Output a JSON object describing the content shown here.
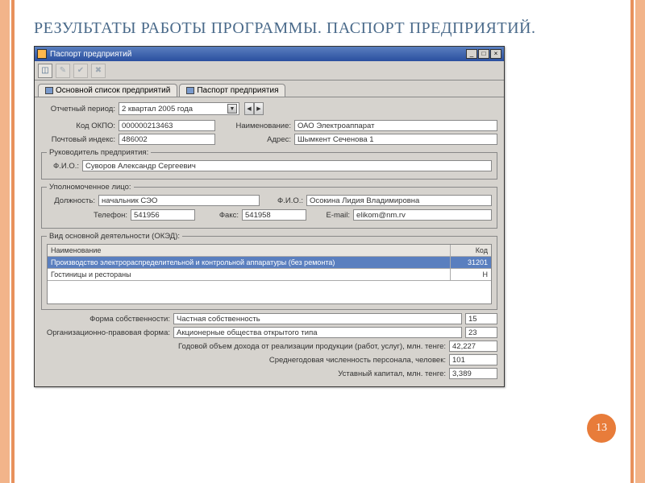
{
  "slide": {
    "title": "РЕЗУЛЬТАТЫ РАБОТЫ ПРОГРАММЫ. ПАСПОРТ ПРЕДПРИЯТИЙ.",
    "page_number": "13"
  },
  "window": {
    "title": "Паспорт предприятий",
    "buttons": {
      "min": "_",
      "max": "□",
      "close": "×"
    }
  },
  "tabs": {
    "list": "Основной список предприятий",
    "passport": "Паспорт предприятия"
  },
  "labels": {
    "period": "Отчетный период:",
    "okpo": "Код ОКПО:",
    "name": "Наименование:",
    "postcode": "Почтовый индекс:",
    "address": "Адрес:",
    "head_legend": "Руководитель предприятия:",
    "fio": "Ф.И.О.:",
    "auth_legend": "Уполномоченное лицо:",
    "position": "Должность:",
    "phone": "Телефон:",
    "fax": "Факс:",
    "email": "E-mail:",
    "oked_legend": "Вид основной деятельности (ОКЭД):",
    "col_name": "Наименование",
    "col_code": "Код",
    "ownership": "Форма собственности:",
    "legal_form": "Организационно-правовая форма:",
    "revenue": "Годовой объем дохода от реализации продукции (работ, услуг), млн. тенге:",
    "headcount": "Среднегодовая численность персонала, человек:",
    "capital": "Уставный капитал, млн. тенге:"
  },
  "values": {
    "period": "2 квартал 2005 года",
    "okpo": "000000213463",
    "name": "ОАО Электроаппарат",
    "postcode": "486002",
    "address": "Шымкент Сеченова 1",
    "head_fio": "Суворов Александр Сергеевич",
    "auth_position": "начальник СЭО",
    "auth_fio": "Осокина Лидия Владимировна",
    "phone": "541956",
    "fax": "541958",
    "email": "elikom@nm.rv",
    "activity1_name": "Производство электрораспределительной и контрольной аппаратуры (без ремонта)",
    "activity1_code": "31201",
    "activity2_name": "Гостиницы и рестораны",
    "activity2_code": "H",
    "ownership": "Частная собственность",
    "ownership_code": "15",
    "legal_form": "Акционерные общества открытого типа",
    "legal_form_code": "23",
    "revenue": "42,227",
    "headcount": "101",
    "capital": "3,389"
  },
  "icons": {
    "doc": "◫",
    "edit": "✎",
    "save": "✔",
    "cancel": "✖",
    "arrow_left": "◀",
    "arrow_right": "▶",
    "arrow_down": "▼"
  }
}
